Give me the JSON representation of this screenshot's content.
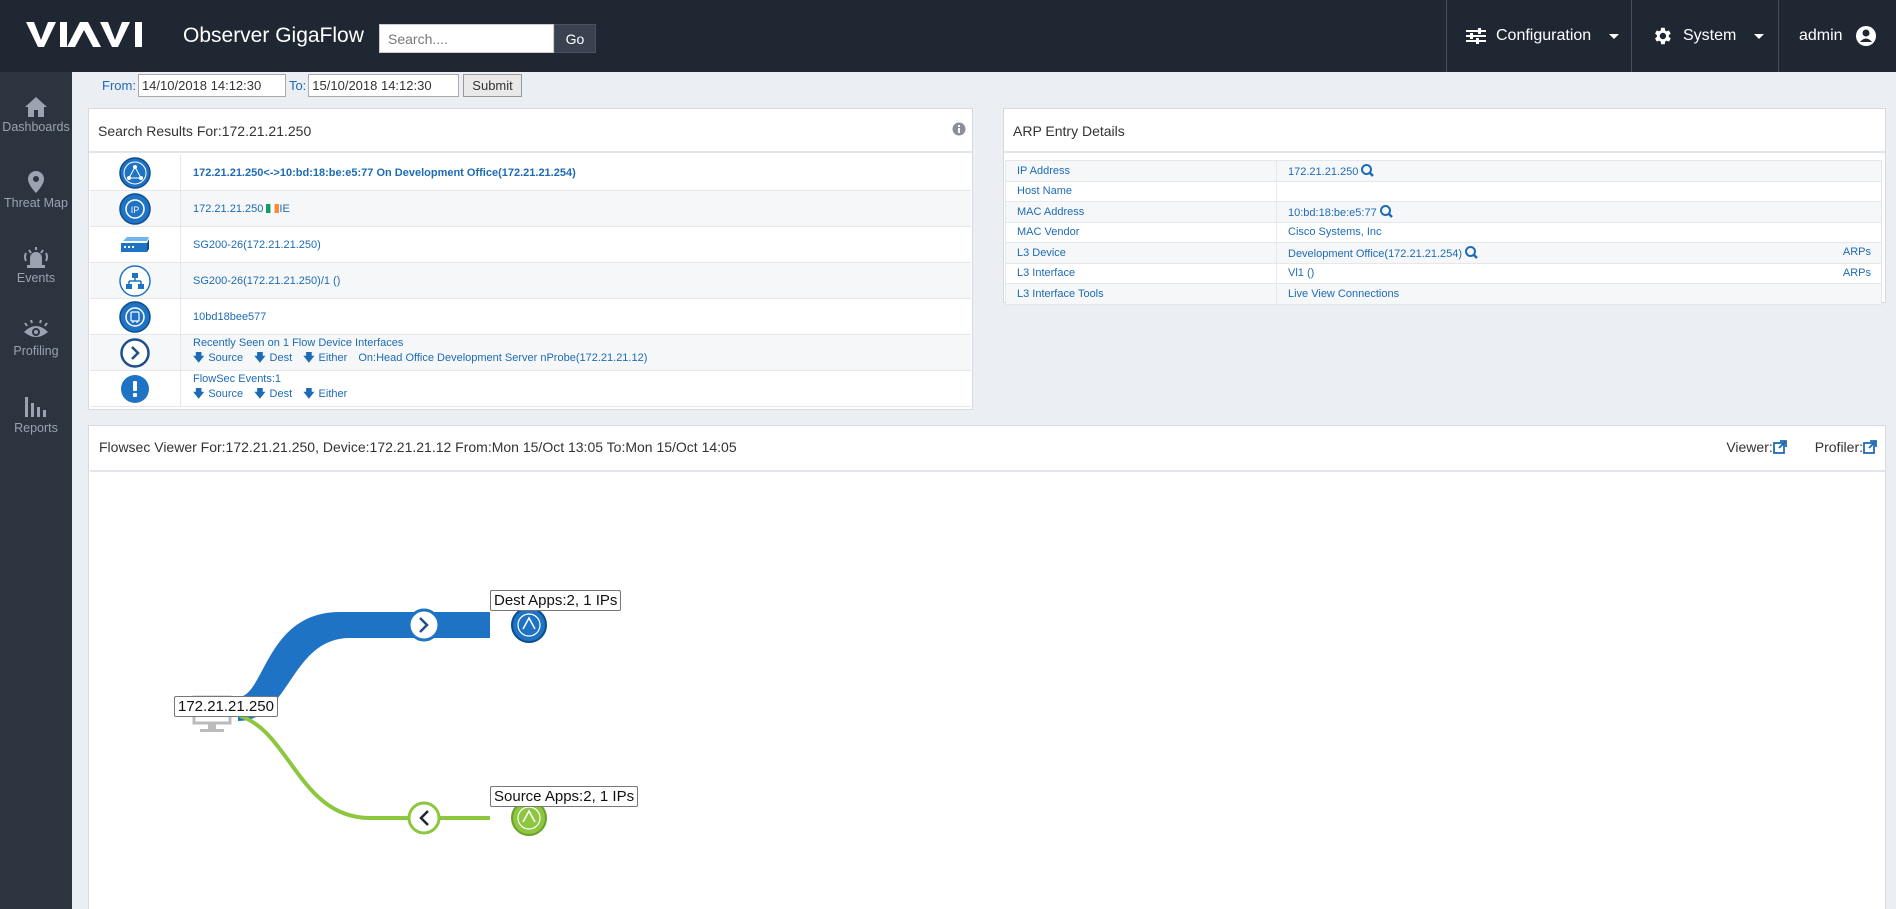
{
  "header": {
    "app_title": "Observer GigaFlow",
    "search_placeholder": "Search....",
    "go_label": "Go",
    "nav": [
      {
        "label": "Configuration",
        "icon": "sliders-icon"
      },
      {
        "label": "System",
        "icon": "gear-icon"
      },
      {
        "label": "admin",
        "icon": "user-icon"
      }
    ]
  },
  "sidebar": {
    "items": [
      {
        "label": "Dashboards",
        "icon": "home-icon"
      },
      {
        "label": "Threat Map",
        "icon": "map-pin-icon"
      },
      {
        "label": "Events",
        "icon": "alarm-icon"
      },
      {
        "label": "Profiling",
        "icon": "eye-icon"
      },
      {
        "label": "Reports",
        "icon": "bar-chart-icon"
      }
    ]
  },
  "daterange": {
    "from_label": "From:",
    "from_value": "14/10/2018 14:12:30",
    "to_label": "To:",
    "to_value": "15/10/2018 14:12:30",
    "submit_label": "Submit"
  },
  "search_results": {
    "title": "Search Results For:172.21.21.250",
    "rows": [
      {
        "icon": "network-icon",
        "text": "172.21.21.250<->10:bd:18:be:e5:77 On Development Office(172.21.21.254)"
      },
      {
        "icon": "ip-icon",
        "text": "172.21.21.250",
        "suffix": "IE"
      },
      {
        "icon": "switch-icon",
        "text": "SG200-26(172.21.21.250)"
      },
      {
        "icon": "interface-icon",
        "text": "SG200-26(172.21.21.250)/1 ()"
      },
      {
        "icon": "mac-icon",
        "text": "10bd18bee577"
      },
      {
        "icon": "chevron-right-icon",
        "text": "Recently Seen on 1 Flow Device Interfaces",
        "links": [
          "Source",
          "Dest",
          "Either"
        ],
        "extra": "On:Head Office Development Server nProbe(172.21.21.12)"
      },
      {
        "icon": "alert-icon",
        "text": "FlowSec Events:1",
        "links": [
          "Source",
          "Dest",
          "Either"
        ]
      }
    ]
  },
  "arp": {
    "title": "ARP Entry Details",
    "rows": [
      {
        "key": "IP Address",
        "value": "172.21.21.250",
        "zoom": true,
        "right": ""
      },
      {
        "key": "Host Name",
        "value": "",
        "zoom": false,
        "right": ""
      },
      {
        "key": "MAC Address",
        "value": "10:bd:18:be:e5:77",
        "zoom": true,
        "right": ""
      },
      {
        "key": "MAC Vendor",
        "value": "Cisco Systems, Inc",
        "zoom": false,
        "right": ""
      },
      {
        "key": "L3 Device",
        "value": "Development Office(172.21.21.254)",
        "zoom": true,
        "right": "ARPs"
      },
      {
        "key": "L3 Interface",
        "value": "Vl1 ()",
        "zoom": false,
        "right": "ARPs"
      },
      {
        "key": "L3 Interface Tools",
        "value": "Live View Connections",
        "zoom": false,
        "right": ""
      }
    ]
  },
  "flowsec": {
    "title": "Flowsec Viewer For:172.21.21.250, Device:172.21.21.12 From:Mon 15/Oct 13:05 To:Mon 15/Oct 14:05",
    "viewer_label": "Viewer:",
    "profiler_label": "Profiler:",
    "host_label": "172.21.21.250",
    "dest_label": "Dest Apps:2, 1 IPs",
    "source_label": "Source Apps:2, 1 IPs",
    "colors": {
      "dest": "#1f73c4",
      "source": "#8dc63f"
    }
  }
}
